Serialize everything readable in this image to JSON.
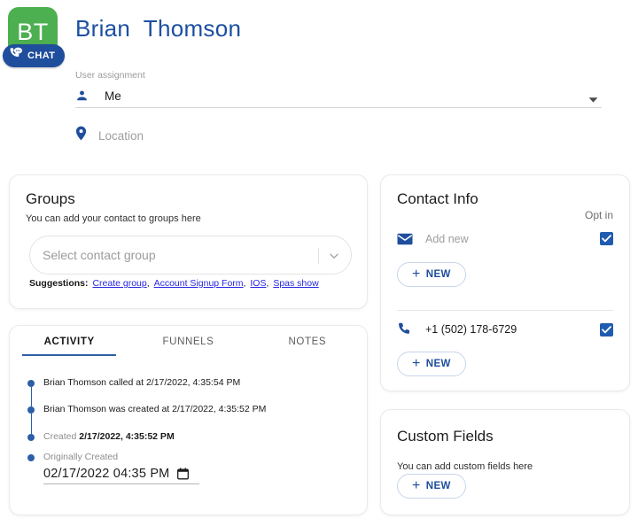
{
  "header": {
    "avatar_initials": "BT",
    "avatar_color": "#4caf50",
    "chat_badge_label": "CHAT",
    "chat_badge_color": "#1f4e9c",
    "contact_name": "Brian  Thomson",
    "contact_name_color": "#1c4fa1",
    "assignment_label": "User assignment",
    "assignment_value": "Me",
    "location_placeholder": "Location"
  },
  "groups": {
    "title": "Groups",
    "subtitle": "You can add your contact to groups here",
    "select_placeholder": "Select contact group",
    "suggestions_label": "Suggestions:",
    "suggestions": [
      "Create group",
      "Account Signup Form",
      "IOS",
      "Spas show"
    ]
  },
  "activity": {
    "tabs": [
      {
        "label": "ACTIVITY",
        "active": true
      },
      {
        "label": "FUNNELS",
        "active": false
      },
      {
        "label": "NOTES",
        "active": false
      }
    ],
    "timeline": [
      {
        "text": "Brian Thomson called at 2/17/2022, 4:35:54 PM",
        "muted": false
      },
      {
        "text": "Brian Thomson was created at 2/17/2022, 4:35:52 PM",
        "muted": false
      }
    ],
    "created_label": "Created",
    "created_value": "2/17/2022, 4:35:52 PM",
    "originally_created_label": "Originally Created",
    "originally_created_value": "02/17/2022 04:35 PM"
  },
  "contact_info": {
    "title": "Contact Info",
    "optin_label": "Opt in",
    "email_placeholder": "Add new",
    "email_optin_checked": true,
    "email_new_label": "NEW",
    "phone_value": "+1 (502) 178-6729",
    "phone_optin_checked": true,
    "phone_new_label": "NEW",
    "plus_glyph": "+"
  },
  "custom_fields": {
    "title": "Custom Fields",
    "subtitle": "You can add custom fields here",
    "new_label": "NEW",
    "plus_glyph": "+"
  }
}
